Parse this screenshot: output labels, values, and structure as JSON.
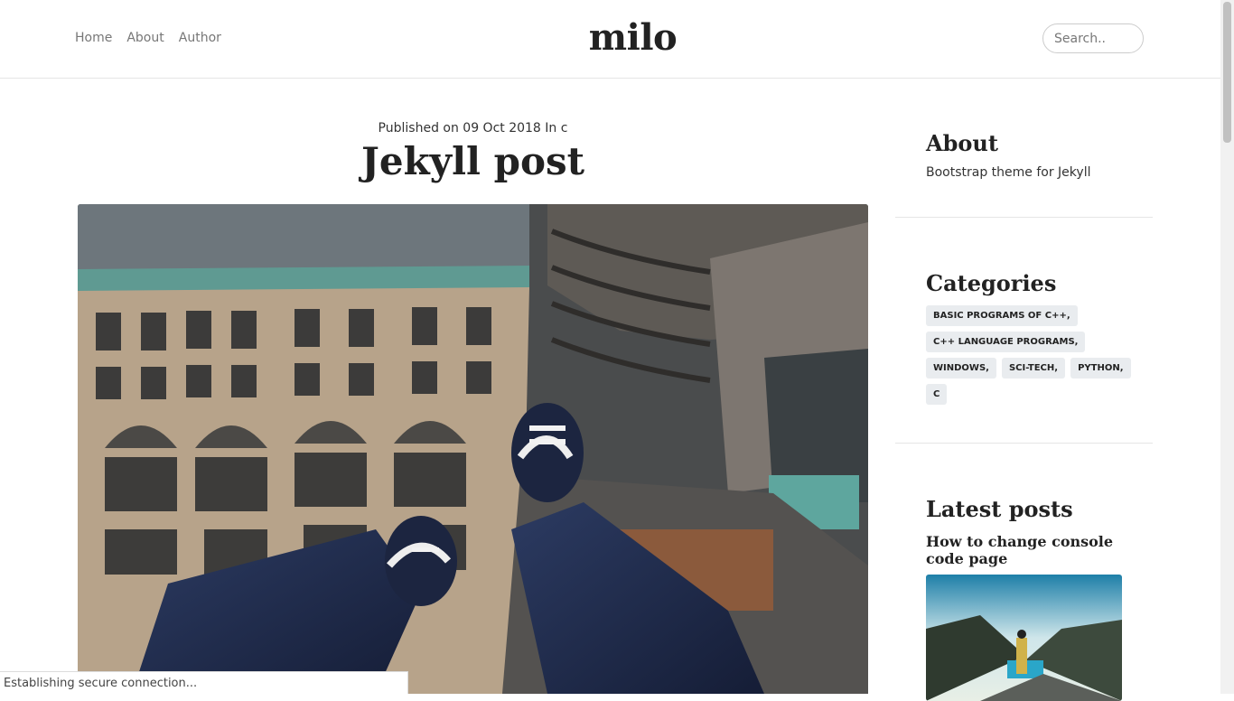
{
  "nav": {
    "home": "Home",
    "about": "About",
    "author": "Author"
  },
  "site_title": "milo",
  "search": {
    "placeholder": "Search.."
  },
  "post": {
    "meta": "Published on 09 Oct 2018 In c",
    "title": "Jekyll post"
  },
  "sidebar": {
    "about_heading": "About",
    "about_text": "Bootstrap theme for Jekyll",
    "categories_heading": "Categories",
    "categories": [
      "BASIC PROGRAMS OF C++,",
      "C++ LANGUAGE PROGRAMS,",
      "WINDOWS,",
      "SCI-TECH,",
      "PYTHON,",
      "C"
    ],
    "latest_heading": "Latest posts",
    "latest_title": "How to change console code page"
  },
  "status_text": "Establishing secure connection..."
}
